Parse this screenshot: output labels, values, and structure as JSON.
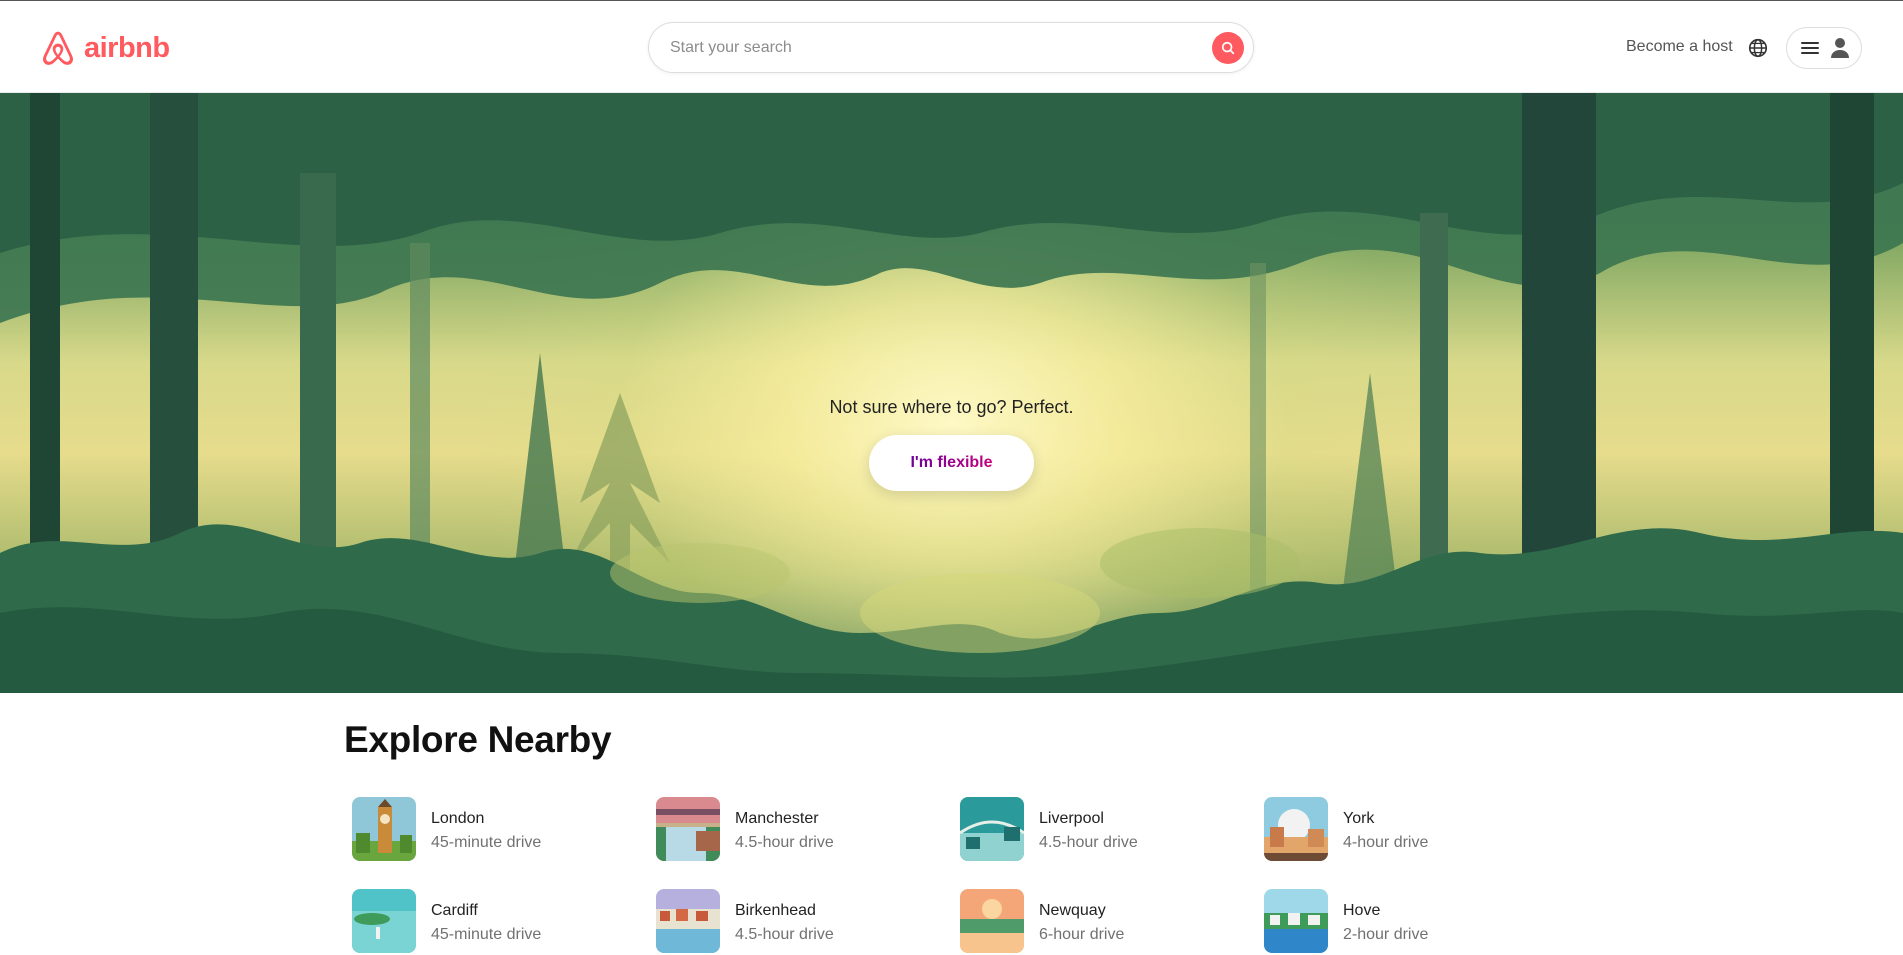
{
  "header": {
    "logo_text": "airbnb",
    "search_placeholder": "Start your search",
    "host_link": "Become a host",
    "brand_color": "#ff5a5f"
  },
  "hero": {
    "tagline": "Not sure where to go? Perfect.",
    "button_label": "I'm flexible"
  },
  "explore": {
    "title": "Explore Nearby",
    "items": [
      {
        "name": "London",
        "distance": "45-minute drive",
        "thumb": "london-illustration"
      },
      {
        "name": "Manchester",
        "distance": "4.5-hour drive",
        "thumb": "manchester-illustration"
      },
      {
        "name": "Liverpool",
        "distance": "4.5-hour drive",
        "thumb": "liverpool-illustration"
      },
      {
        "name": "York",
        "distance": "4-hour drive",
        "thumb": "york-illustration"
      },
      {
        "name": "Cardiff",
        "distance": "45-minute drive",
        "thumb": "cardiff-illustration"
      },
      {
        "name": "Birkenhead",
        "distance": "4.5-hour drive",
        "thumb": "birkenhead-illustration"
      },
      {
        "name": "Newquay",
        "distance": "6-hour drive",
        "thumb": "newquay-illustration"
      },
      {
        "name": "Hove",
        "distance": "2-hour drive",
        "thumb": "hove-illustration"
      }
    ]
  }
}
